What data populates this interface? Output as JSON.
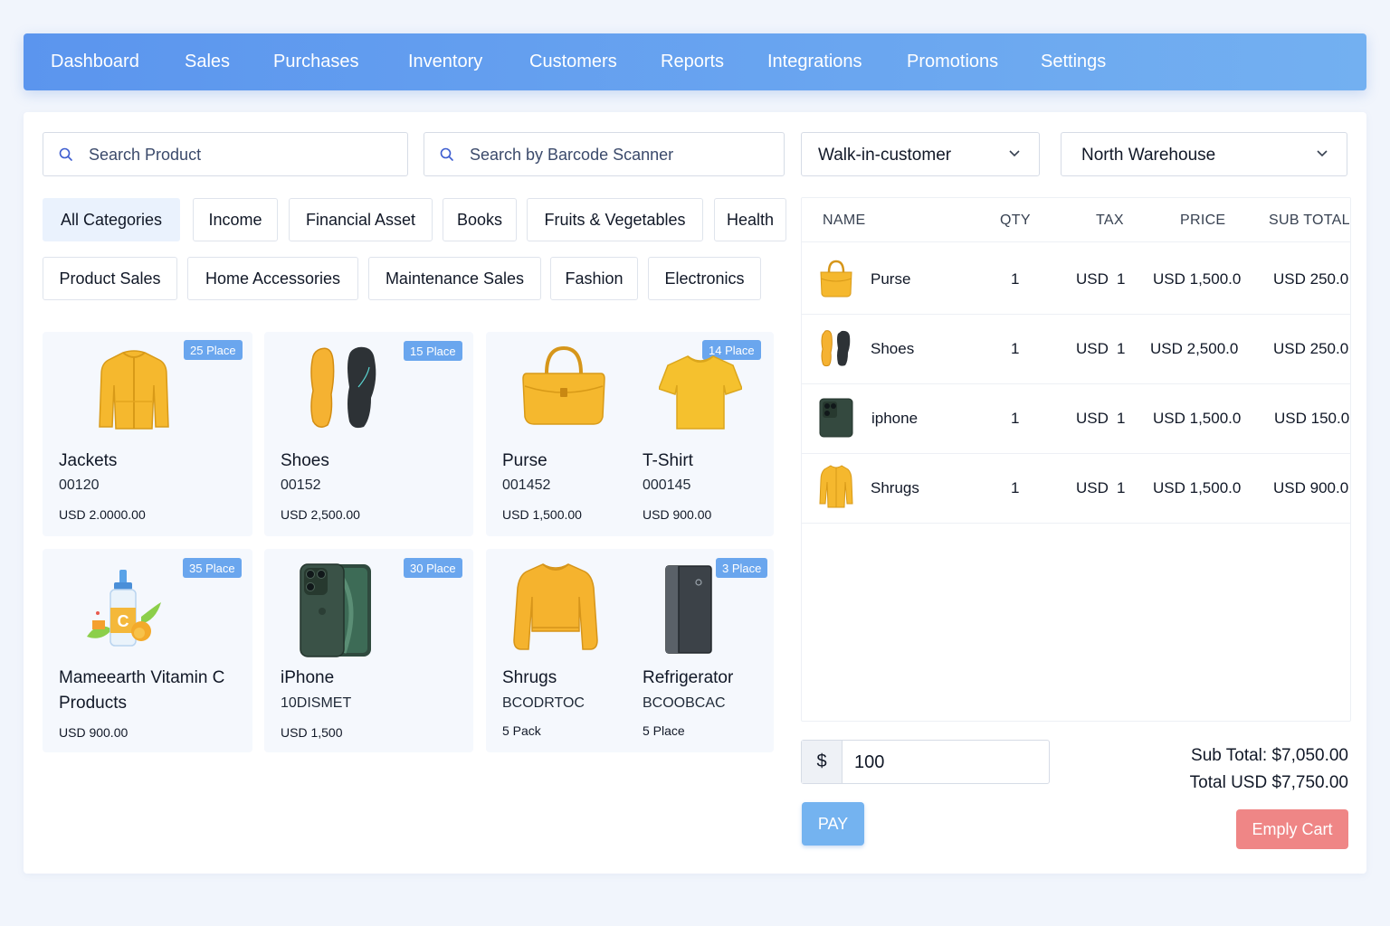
{
  "nav": {
    "items": [
      "Dashboard",
      "Sales",
      "Purchases",
      "Inventory",
      "Customers",
      "Reports",
      "Integrations",
      "Promotions",
      "Settings"
    ]
  },
  "search": {
    "product_placeholder": "Search Product",
    "barcode_placeholder": "Search by Barcode Scanner"
  },
  "customer_select": {
    "value": "Walk-in-customer"
  },
  "warehouse_select": {
    "value": "North Warehouse"
  },
  "categories": {
    "row1": [
      "All Categories",
      "Income",
      "Financial Asset",
      "Books",
      "Fruits & Vegetables",
      "Health"
    ],
    "row2": [
      "Product Sales",
      "Home Accessories",
      "Maintenance Sales",
      "Fashion",
      "Electronics"
    ],
    "active": "All Categories"
  },
  "products": [
    {
      "name": "Jackets",
      "code": "00120",
      "price": "USD 2.0000.00",
      "badge": "25 Place",
      "icon": "jacket-icon"
    },
    {
      "name": "Shoes",
      "code": "00152",
      "price": "USD 2,500.00",
      "badge": "15 Place",
      "icon": "shoes-icon"
    },
    {
      "name": "Purse",
      "code": "001452",
      "price": "USD 1,500.00",
      "badge": "",
      "icon": "purse-icon"
    },
    {
      "name": "T-Shirt",
      "code": "000145",
      "price": "USD 900.00",
      "badge": "14 Place",
      "icon": "tshirt-icon"
    },
    {
      "name": "Mameearth Vitamin C Products",
      "code": "",
      "price": "USD 900.00",
      "badge": "35 Place",
      "icon": "serum-bottle-icon"
    },
    {
      "name": "iPhone",
      "code": "10DISMET",
      "price": "USD 1,500",
      "badge": "30 Place",
      "icon": "phone-icon"
    },
    {
      "name": "Shrugs",
      "code": "BCODRTOC",
      "price": "5 Pack",
      "badge": "",
      "icon": "sweater-icon"
    },
    {
      "name": "Refrigerator",
      "code": "BCOOBCAC",
      "price": "5 Place",
      "badge": "3 Place",
      "icon": "refrigerator-icon"
    }
  ],
  "cart": {
    "headers": {
      "name": "NAME",
      "qty": "QTY",
      "tax": "TAX",
      "price": "PRICE",
      "subtotal": "SUB TOTAL"
    },
    "rows": [
      {
        "name": "Purse",
        "qty": "1",
        "tax_cur": "USD",
        "tax": "1",
        "price": "USD 1,500.0",
        "subtotal": "USD 250.0",
        "icon": "purse-icon"
      },
      {
        "name": "Shoes",
        "qty": "1",
        "tax_cur": "USD",
        "tax": "1",
        "price": "USD 2,500.0",
        "subtotal": "USD 250.0",
        "icon": "shoes-icon"
      },
      {
        "name": "iphone",
        "qty": "1",
        "tax_cur": "USD",
        "tax": "1",
        "price": "USD 1,500.0",
        "subtotal": "USD 150.0",
        "icon": "phone-icon"
      },
      {
        "name": "Shrugs",
        "qty": "1",
        "tax_cur": "USD",
        "tax": "1",
        "price": "USD 1,500.0",
        "subtotal": "USD 900.0",
        "icon": "shrug-icon"
      }
    ]
  },
  "payment": {
    "currency_symbol": "$",
    "amount": "100",
    "pay_label": "PAY",
    "empty_label": "Emply Cart",
    "sub_total": "Sub Total: $7,050.00",
    "total": "Total USD $7,750.00"
  },
  "colors": {
    "nav_start": "#5b95ee",
    "nav_end": "#73b0f1",
    "badge": "#6aa6ee",
    "pay": "#74b3f0",
    "empty_cart": "#ef8686",
    "product_yellow": "#f5b82e"
  }
}
